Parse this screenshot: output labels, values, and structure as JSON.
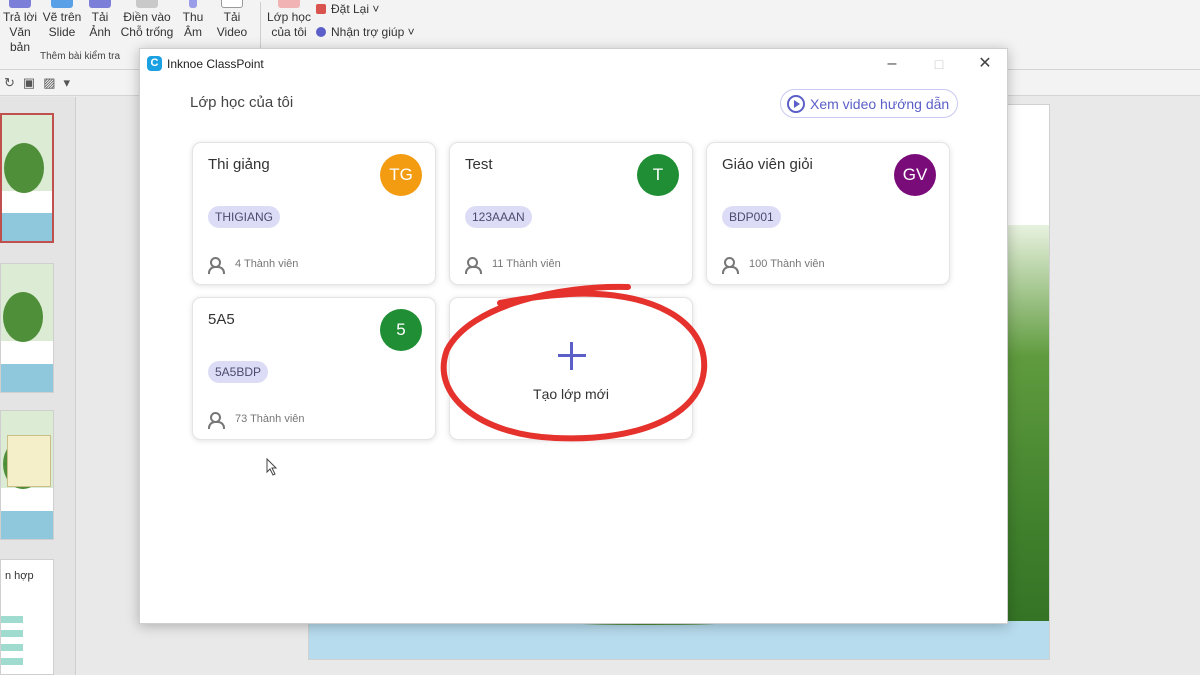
{
  "ribbon": {
    "buttons": [
      {
        "label": "Trả lời Văn bản"
      },
      {
        "label": "Vẽ trên Slide"
      },
      {
        "label": "Tải Ảnh"
      },
      {
        "label": "Điền vào Chỗ trống"
      },
      {
        "label": "Thu Âm"
      },
      {
        "label": "Tải Video"
      }
    ],
    "group_label": "Thêm bài kiểm tra",
    "my_classes_label": "Lớp học của tôi",
    "reset_label": "Đặt Lại",
    "help_label": "Nhận trợ giúp"
  },
  "thumbnails": {
    "slide5_title": "n hợp"
  },
  "dialog": {
    "app_title": "Inknoe ClassPoint",
    "section_title": "Lớp học của tôi",
    "video_button": "Xem video hướng dẫn",
    "classes": [
      {
        "name": "Thi giảng",
        "initials": "TG",
        "code": "THIGIANG",
        "members": "4 Thành viên",
        "color": "#f39c12"
      },
      {
        "name": "Test",
        "initials": "T",
        "code": "123AAAN",
        "members": "11 Thành viên",
        "color": "#1f8e34"
      },
      {
        "name": "Giáo viên giỏi",
        "initials": "GV",
        "code": "BDP001",
        "members": "100 Thành viên",
        "color": "#7a0c7a"
      },
      {
        "name": "5A5",
        "initials": "5",
        "code": "5A5BDP",
        "members": "73 Thành viên",
        "color": "#1f8e34"
      }
    ],
    "new_class_label": "Tạo lớp mới"
  },
  "colors": {
    "accent": "#5b5fc7",
    "annotation": "#e5322d"
  }
}
